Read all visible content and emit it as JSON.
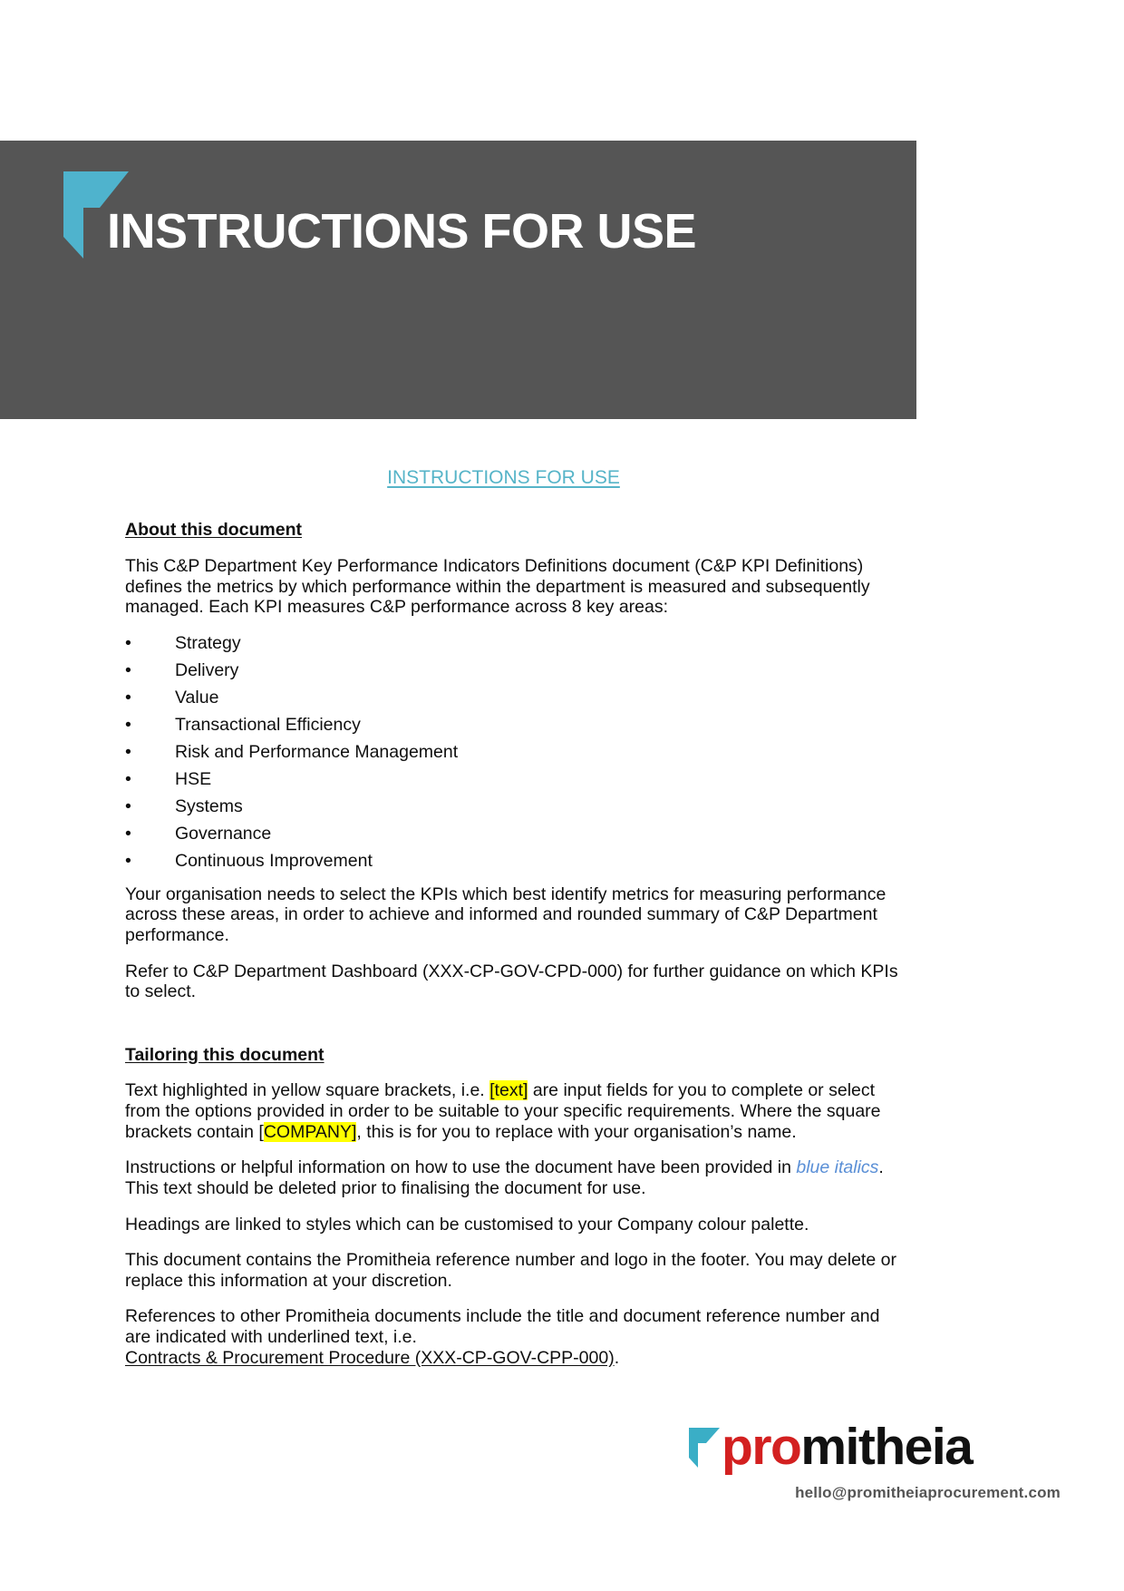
{
  "banner": {
    "title": "INSTRUCTIONS FOR USE",
    "logo_mark_name": "promitheia-flag-mark",
    "background_color": "#555555",
    "mark_color": "#4fb3cd",
    "title_color": "#ffffff"
  },
  "document": {
    "title": "INSTRUCTIONS FOR USE",
    "title_color": "#56b4c8",
    "sections": {
      "about": {
        "heading": "About this document",
        "intro_paragraph": "This C&P Department Key Performance Indicators Definitions document (C&P KPI Definitions) defines the metrics by which performance within the department is measured and subsequently managed.  Each KPI measures C&P performance across 8 key areas:",
        "key_areas": [
          "Strategy",
          "Delivery",
          "Value",
          "Transactional Efficiency",
          "Risk and Performance Management",
          "HSE",
          "Systems",
          "Governance",
          "Continuous Improvement"
        ],
        "paragraph_select_kpis": "Your organisation needs to select the KPIs which best identify metrics for measuring performance across these areas, in order to achieve and informed and rounded summary of C&P Department performance.",
        "paragraph_refer": "Refer to C&P Department Dashboard (XXX-CP-GOV-CPD-000) for further guidance on which KPIs to select."
      },
      "tailoring": {
        "heading": "Tailoring this document",
        "highlight_color": "#ffff00",
        "blue_italics_color": "#5a8fd6",
        "para_brackets": {
          "part1": "Text highlighted in yellow square brackets, i.e. ",
          "highlight1": "[text]",
          "part2": " are input fields for you to complete or select from the options provided in order to be suitable to your specific requirements.  Where the square brackets contain ",
          "bracket_open": "[",
          "highlight2": "COMPANY]",
          "part3": ", this is for you to replace with your organisation’s name."
        },
        "para_italics": {
          "part1": "Instructions or helpful information on how to use the document have been provided in ",
          "italic_text": "blue italics",
          "part2": ".  This text should be deleted prior to finalising the document for use."
        },
        "para_headings": "Headings are linked to styles which can be customised to your Company colour palette.",
        "para_footer_logo": "This document contains the Promitheia reference number and logo in the footer.  You may delete or replace this information at your discretion.",
        "para_references": {
          "part1": "References to other Promitheia documents include the title and document reference number and are indicated with underlined text, i.e.",
          "underlined_reference": "Contracts & Procurement Procedure (XXX-CP-GOV-CPP-000)",
          "part2": "."
        }
      }
    }
  },
  "footer": {
    "logo_mark_name": "promitheia-flag-mark",
    "wordmark_prefix": "pro",
    "wordmark_suffix": "mitheia",
    "wordmark_prefix_color": "#d32020",
    "wordmark_suffix_color": "#111111",
    "mark_color": "#3aaec6",
    "email": "hello@promitheiaprocurement.com"
  }
}
